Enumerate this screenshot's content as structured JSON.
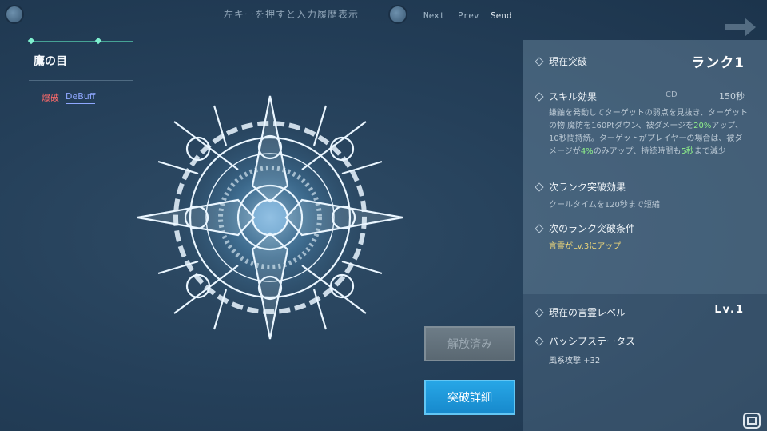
{
  "header": {
    "hint": "左キーを押すと入力履歴表示",
    "nav": {
      "next": "Next",
      "prev": "Prev",
      "send": "Send"
    }
  },
  "skill": {
    "name": "鷹の目",
    "tags": [
      "爆破",
      "DeBuff"
    ]
  },
  "panel": {
    "current_break": {
      "label": "現在突破",
      "value": "ランク1"
    },
    "skill_effect": {
      "label": "スキル効果",
      "cd_label": "CD",
      "cd_value": "150秒",
      "desc_parts": [
        "鎌鼬を発動してターゲットの弱点を見抜き、ターゲットの物 魔防を160Ptダウン、被ダメージを",
        "20%",
        "アップ、10秒間持続。ターゲットがプレイヤーの場合は、被ダメージが",
        "4%",
        "のみアップ、持続時間も",
        "5秒",
        "まで減少"
      ]
    },
    "next_effect": {
      "label": "次ランク突破効果",
      "desc": "クールタイムを120秒まで短縮"
    },
    "next_condition": {
      "label": "次のランク突破条件",
      "desc": "言霊がLv.3にアップ"
    },
    "kotodama_level": {
      "label": "現在の言霊レベル",
      "value": "Lv.1"
    },
    "passive": {
      "label": "パッシブステータス",
      "desc": "風系攻撃 +32"
    }
  },
  "buttons": {
    "released": "解放済み",
    "detail": "突破詳細"
  },
  "colors": {
    "accent_blue": "#1f98dc",
    "highlight_green": "#8ff08a",
    "condition_yellow": "#f0d87a",
    "tag_red": "#ff6a6a",
    "tag_blue": "#8fa8ff"
  },
  "icons": {
    "top_left": "circle-button-icon",
    "top_mid": "circle-button-icon",
    "top_right": "arrow-right-icon",
    "emblem": "star-compass-emblem",
    "watermark": "logo-icon"
  }
}
